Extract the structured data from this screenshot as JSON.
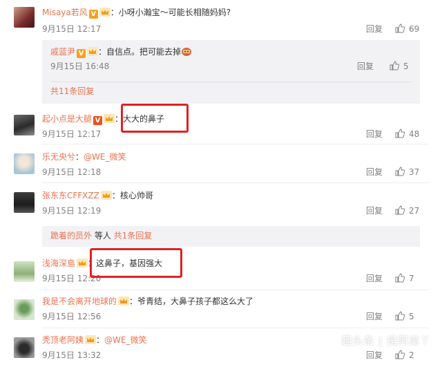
{
  "comments": [
    {
      "user": "Misaya若风",
      "text": "小呀小瀚宝～可能长相随妈妈?",
      "time": "9月15日 12:17",
      "reply": "回复",
      "likes": "69"
    },
    {
      "user": "起小点是大腿",
      "text": "大大的鼻子",
      "time": "9月15日 12:17",
      "reply": "回复",
      "likes": "48"
    },
    {
      "user": "乐无央兮",
      "text": "@WE_微笑",
      "time": "9月15日 12:18",
      "reply": "回复",
      "likes": "37"
    },
    {
      "user": "张东东CFFXZZ",
      "text": "核心帅哥",
      "time": "9月15日 12:19",
      "reply": "回复",
      "likes": "27"
    },
    {
      "user": "浅海深島",
      "text": "这鼻子，基因强大",
      "time": "9月15日 12:20",
      "reply": "回复",
      "likes": "7"
    },
    {
      "user": "我是不会离开地球的",
      "text": "爷青结，大鼻子孩子都这么大了",
      "time": "9月15日 12:56",
      "reply": "回复",
      "likes": "5"
    },
    {
      "user": "秃顶老阿姨",
      "text": "@WE_微笑",
      "time": "9月15日 13:32",
      "reply": "回复",
      "likes": "2"
    }
  ],
  "subreply": {
    "user": "戚蓝尹",
    "text": "自信点。把可能去掉",
    "time": "9月15日 16:48",
    "reply": "回复",
    "likes": "5",
    "more": "共11条回复"
  },
  "subreply2": {
    "user": "跪着的员外",
    "mid": " 等人 ",
    "more": "共1条回复"
  },
  "colon": "：",
  "watermark": "趣头条 | 是阿离丫",
  "colors": {
    "accent": "#eb7350",
    "highlight": "#e02020",
    "muted": "#808080"
  }
}
